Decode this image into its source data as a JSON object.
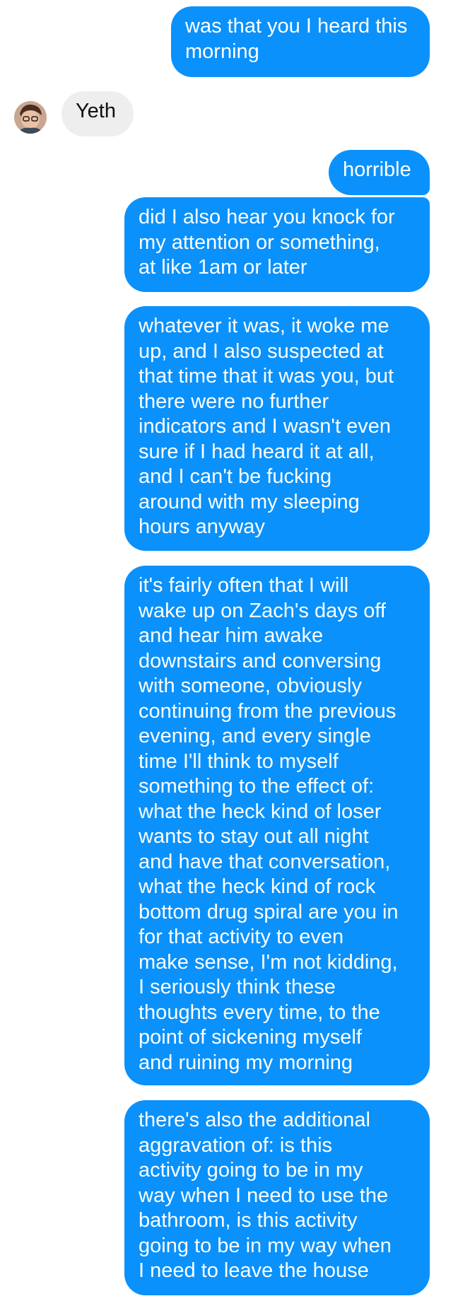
{
  "conversation": {
    "messages": [
      {
        "sender": "me",
        "text": "was that you I heard this\nmorning"
      },
      {
        "sender": "contact",
        "text": "Yeth"
      },
      {
        "sender": "me",
        "text": "horrible"
      },
      {
        "sender": "me",
        "text": "did I also hear you knock for\nmy attention or something,\nat like 1am or later"
      },
      {
        "sender": "me",
        "text": "whatever it was, it woke me\nup, and I also suspected at\nthat time that it was you, but\nthere were no further\nindicators and I wasn't even\nsure if I had heard it at all,\nand I can't be fucking\naround with my sleeping\nhours anyway"
      },
      {
        "sender": "me",
        "text": "it's fairly often that I will\nwake up on Zach's days off\nand hear him awake\ndownstairs and conversing\nwith someone, obviously\ncontinuing from the previous\nevening, and every single\ntime I'll think to myself\nsomething to the effect of:\nwhat the heck kind of loser\nwants to stay out all night\nand have that conversation,\nwhat the heck kind of rock\nbottom drug spiral are you in\nfor that activity to even\nmake sense, I'm not kidding,\nI seriously think these\nthoughts every time, to the\npoint of sickening myself\nand ruining my morning"
      },
      {
        "sender": "me",
        "text": "there's also the additional\naggravation of: is this\nactivity going to be in my\nway when I need to use the\nbathroom, is this activity\ngoing to be in my way when\nI need to leave the house"
      }
    ]
  },
  "colors": {
    "outgoing_bubble": "#0a91fb",
    "incoming_bubble": "#eeeeee",
    "background": "#ffffff"
  },
  "icons": {
    "contact_avatar": "contact-avatar-photo"
  }
}
